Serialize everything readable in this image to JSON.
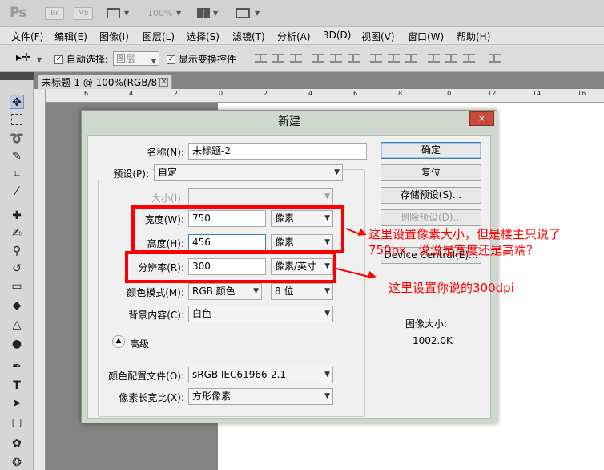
{
  "app": {
    "logo": "Ps",
    "bridge_label": "Br",
    "minibridge_label": "Mb",
    "zoom": "100%"
  },
  "menu": [
    "文件(F)",
    "编辑(E)",
    "图像(I)",
    "图层(L)",
    "选择(S)",
    "滤镜(T)",
    "分析(A)",
    "3D(D)",
    "视图(V)",
    "窗口(W)",
    "帮助(H)"
  ],
  "options": {
    "auto_select_label": "自动选择:",
    "auto_select_value": "图层",
    "show_transform_label": "显示变换控件"
  },
  "document": {
    "tab_title": "未标题-1 @ 100%(RGB/8)",
    "close_glyph": "×",
    "ruler_ticks": [
      "6",
      "4",
      "2",
      "0",
      "2",
      "4",
      "6",
      "8",
      "10",
      "12",
      "14",
      "16",
      "18"
    ]
  },
  "dialog": {
    "title": "新建",
    "close_glyph": "×",
    "name_label": "名称(N):",
    "name_value": "未标题-2",
    "preset_label": "预设(P):",
    "preset_value": "自定",
    "size_label": "大小(I):",
    "width_label": "宽度(W):",
    "width_value": "750",
    "width_unit": "像素",
    "height_label": "高度(H):",
    "height_value": "456",
    "height_unit": "像素",
    "resolution_label": "分辨率(R):",
    "resolution_value": "300",
    "resolution_unit": "像素/英寸",
    "color_mode_label": "颜色模式(M):",
    "color_mode_value": "RGB 颜色",
    "bit_depth_value": "8 位",
    "background_label": "背景内容(C):",
    "background_value": "白色",
    "advanced_label": "高级",
    "color_profile_label": "颜色配置文件(O):",
    "color_profile_value": "sRGB IEC61966-2.1",
    "pixel_aspect_label": "像素长宽比(X):",
    "pixel_aspect_value": "方形像素",
    "buttons": {
      "ok": "确定",
      "reset": "复位",
      "save_preset": "存储预设(S)...",
      "delete_preset": "删除预设(D)...",
      "device_central": "Device Central(E)..."
    },
    "image_size_label": "图像大小:",
    "image_size_value": "1002.0K"
  },
  "annotations": {
    "note1_line1": "这里设置像素大小，但是楼主只说了",
    "note1_line2": "750px，说说是宽度还是高端？",
    "note2": "这里设置你说的300dpi",
    "color": "#ff0000"
  }
}
